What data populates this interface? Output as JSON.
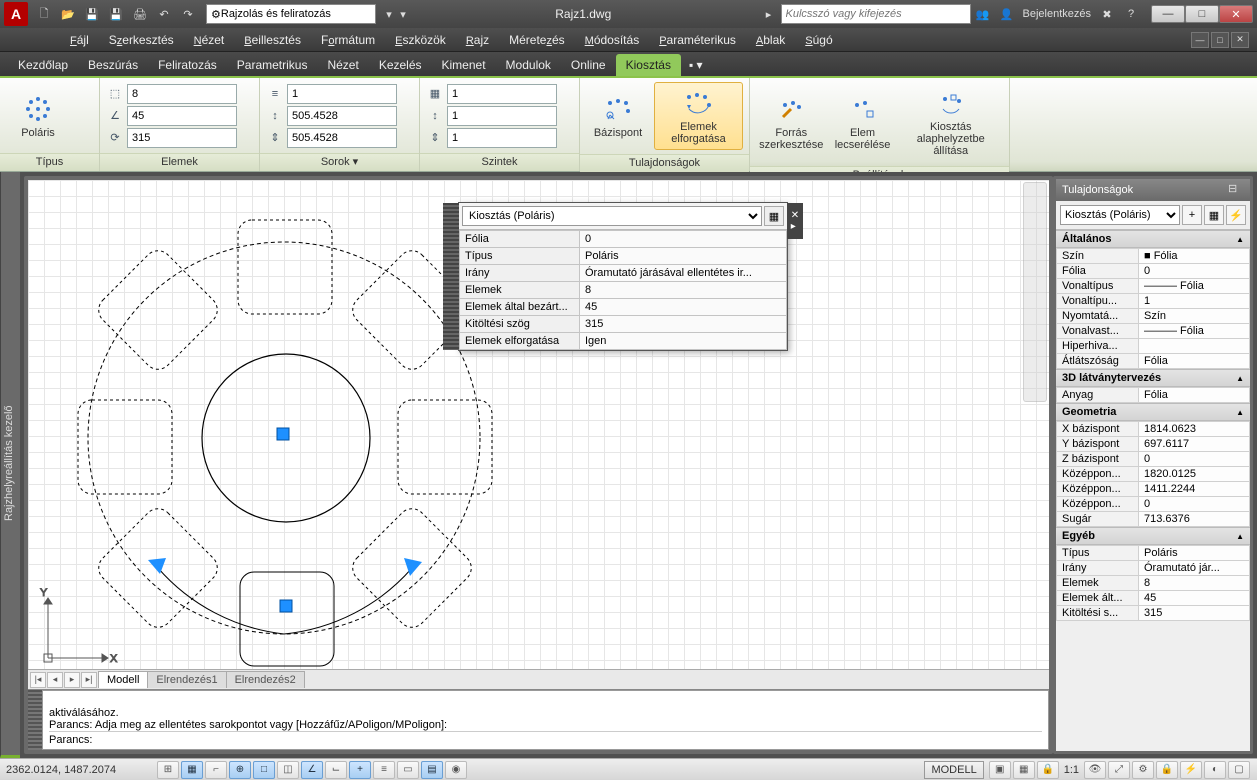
{
  "title": "Rajz1.dwg",
  "workspace": "Rajzolás és feliratozás",
  "search_placeholder": "Kulcsszó vagy kifejezés",
  "signin": "Bejelentkezés",
  "menus": [
    "Fájl",
    "Szerkesztés",
    "Nézet",
    "Beillesztés",
    "Formátum",
    "Eszközök",
    "Rajz",
    "Méretezés",
    "Módosítás",
    "Paraméterikus",
    "Ablak",
    "Súgó"
  ],
  "ribbon_tabs": [
    "Kezdőlap",
    "Beszúrás",
    "Feliratozás",
    "Parametrikus",
    "Nézet",
    "Kezelés",
    "Kimenet",
    "Modulok",
    "Online",
    "Kiosztás"
  ],
  "ribbon_active": "Kiosztás",
  "ribbon": {
    "tipus": {
      "btn": "Poláris",
      "title": "Típus"
    },
    "elemek": {
      "f1": "8",
      "f2": "45",
      "f3": "315",
      "title": "Elemek"
    },
    "sorok": {
      "f1": "1",
      "f2": "505.4528",
      "f3": "505.4528",
      "title": "Sorok ▾"
    },
    "szintek": {
      "f1": "1",
      "f2": "1",
      "f3": "1",
      "title": "Szintek"
    },
    "tulaj": {
      "b1": "Bázispont",
      "b2": "Elemek elforgatása",
      "title": "Tulajdonságok"
    },
    "beall": {
      "b1": "Forrás\nszerkesztése",
      "b2": "Elem\nlecserélése",
      "b3": "Kiosztás\nalaphelyzetbe állítása",
      "title": "Beállítások"
    }
  },
  "qp": {
    "header": "Kiosztás (Poláris)",
    "rows": [
      [
        "Fólia",
        "0"
      ],
      [
        "Típus",
        "Poláris"
      ],
      [
        "Irány",
        "Óramutató járásával ellentétes ir..."
      ],
      [
        "Elemek",
        "8"
      ],
      [
        "Elemek által bezárt...",
        "45"
      ],
      [
        "Kitöltési szög",
        "315"
      ],
      [
        "Elemek elforgatása",
        "Igen"
      ]
    ]
  },
  "props": {
    "title": "Tulajdonságok",
    "type": "Kiosztás (Poláris)",
    "sections": [
      {
        "name": "Általános",
        "rows": [
          [
            "Szín",
            "■ Fólia"
          ],
          [
            "Fólia",
            "0"
          ],
          [
            "Vonaltípus",
            "——— Fólia"
          ],
          [
            "Vonaltípu...",
            "1"
          ],
          [
            "Nyomtatá...",
            "Szín"
          ],
          [
            "Vonalvast...",
            "——— Fólia"
          ],
          [
            "Hiperhiva...",
            ""
          ],
          [
            "Átlátszóság",
            "Fólia"
          ]
        ]
      },
      {
        "name": "3D látványtervezés",
        "rows": [
          [
            "Anyag",
            "Fólia"
          ]
        ]
      },
      {
        "name": "Geometria",
        "rows": [
          [
            "X bázispont",
            "1814.0623"
          ],
          [
            "Y bázispont",
            "697.6117"
          ],
          [
            "Z bázispont",
            "0"
          ],
          [
            "Középpon...",
            "1820.0125"
          ],
          [
            "Középpon...",
            "1411.2244"
          ],
          [
            "Középpon...",
            "0"
          ],
          [
            "Sugár",
            "713.6376"
          ]
        ]
      },
      {
        "name": "Egyéb",
        "rows": [
          [
            "Típus",
            "Poláris"
          ],
          [
            "Irány",
            "Óramutató jár..."
          ],
          [
            "Elemek",
            "8"
          ],
          [
            "Elemek ált...",
            "45"
          ],
          [
            "Kitöltési s...",
            "315"
          ]
        ]
      }
    ]
  },
  "layout_tabs": [
    "Modell",
    "Elrendezés1",
    "Elrendezés2"
  ],
  "cmd": {
    "l1": "aktiválásához.",
    "l2": "Parancs: Adja meg az ellentétes sarokpontot vagy [Hozzáfűz/APoligon/MPoligon]:",
    "l3": "Parancs:"
  },
  "status": {
    "coords": "2362.0124, 1487.2074",
    "model": "MODELL",
    "scale": "1:1"
  },
  "vtab": "Rajzhelyreállítás kezelő"
}
